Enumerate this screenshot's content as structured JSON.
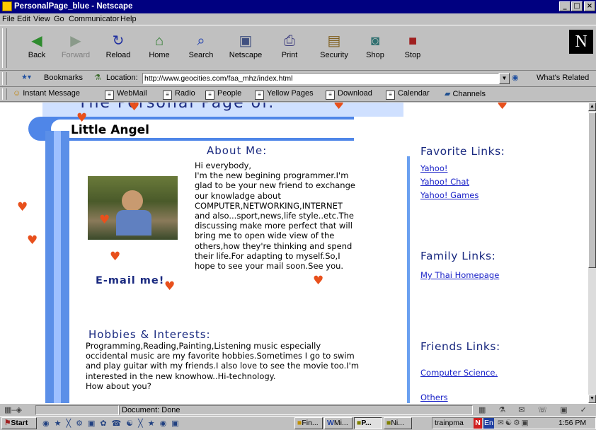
{
  "window": {
    "title": "PersonalPage_blue - Netscape",
    "minimize_glyph": "_",
    "maximize_glyph": "□",
    "close_glyph": "×"
  },
  "menu": [
    "File",
    "Edit",
    "View",
    "Go",
    "Communicator",
    "Help"
  ],
  "nav_buttons": [
    {
      "label": "Back",
      "icon": "back-arrow-icon",
      "glyph": "◀",
      "color": "#2e8b2e"
    },
    {
      "label": "Forward",
      "icon": "forward-arrow-icon",
      "glyph": "▶",
      "color": "#8a9a8a"
    },
    {
      "label": "Reload",
      "icon": "reload-icon",
      "glyph": "↻",
      "color": "#2030a0"
    },
    {
      "label": "Home",
      "icon": "home-icon",
      "glyph": "⌂",
      "color": "#2a7a2a"
    },
    {
      "label": "Search",
      "icon": "search-icon",
      "glyph": "⌕",
      "color": "#2040b0"
    },
    {
      "label": "Netscape",
      "icon": "netscape-icon",
      "glyph": "▣",
      "color": "#405080"
    },
    {
      "label": "Print",
      "icon": "print-icon",
      "glyph": "⎙",
      "color": "#404080"
    },
    {
      "label": "Security",
      "icon": "lock-icon",
      "glyph": "▤",
      "color": "#806020"
    },
    {
      "label": "Shop",
      "icon": "shop-icon",
      "glyph": "◙",
      "color": "#307070"
    },
    {
      "label": "Stop",
      "icon": "stop-icon",
      "glyph": "■",
      "color": "#a02020"
    }
  ],
  "nav_disabled_label": "Forward",
  "brand_logo": "N",
  "location": {
    "bookmarks_label": "Bookmarks",
    "location_label": "Location:",
    "url": "http://www.geocities.com/faa_mhz/index.html",
    "whats_related": "What's Related"
  },
  "personal_toolbar": [
    "Instant Message",
    "WebMail",
    "Radio",
    "People",
    "Yellow Pages",
    "Download",
    "Calendar",
    "Channels"
  ],
  "page": {
    "banner_partial": "The Personal Page of:",
    "name": "Little Angel",
    "about_title": "About Me:",
    "about_text": "Hi everybody,\nI'm the new begining programmer.I'm\nglad to be your new friend to exchange\nour knowladge about\nCOMPUTER,NETWORKING,INTERNET\nand also...sport,news,life style..etc.The\ndiscussing make more perfect that will\nbring me to open wide view of the\nothers,how they're thinking and spend\ntheir life.For adapting to myself.So,I\nhope to see your mail soon.See you.",
    "email_label": "E-mail me!",
    "hobbies_title": "Hobbies & Interests:",
    "hobbies_text": "Programming,Reading,Painting,Listening music especially\noccidental music are my favorite hobbies.Sometimes I go to swim\nand play guitar with my friends.I also love to see the movie too.I'm\ninterested in the new knowhow..Hi-technology.\nHow about you?",
    "favorite_title": "Favorite Links:",
    "favorite_links": [
      "Yahoo!",
      "Yahoo! Chat",
      "Yahoo! Games"
    ],
    "family_title": "Family Links:",
    "family_links": [
      "My Thai Homepage "
    ],
    "friends_title": "Friends Links:",
    "friends_links": [
      "Computer Science.",
      "Others"
    ],
    "colors": {
      "heading": "#1a2a80",
      "link": "#1a22c8",
      "heart": "#e8501c",
      "accent": "#6aa0f0"
    }
  },
  "status": {
    "text": "Document: Done"
  },
  "taskbar": {
    "start": "Start",
    "tasks": [
      "Fin...",
      "Mi...",
      "P...",
      "Ni..."
    ],
    "input_indicator": "trainpma",
    "lang": "En",
    "clock": "1:56 PM"
  }
}
